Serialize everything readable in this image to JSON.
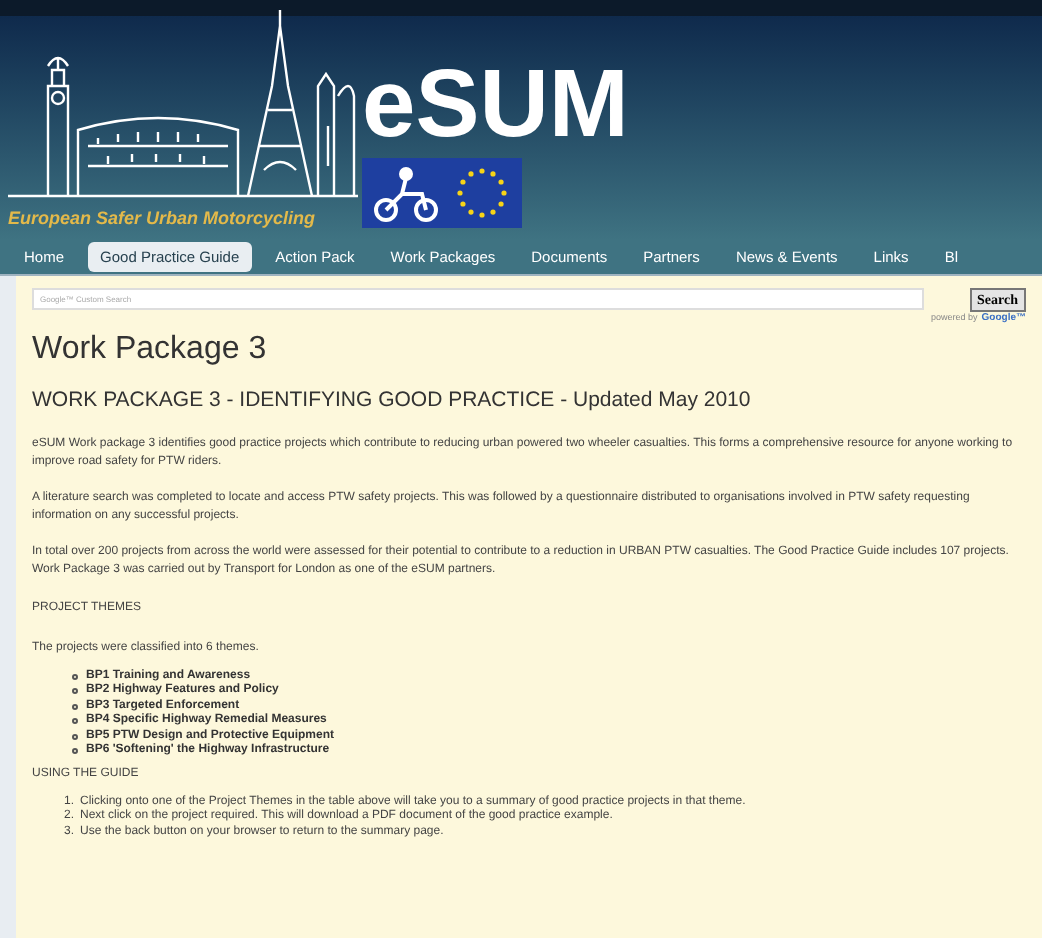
{
  "header": {
    "logo_text": "eSUM",
    "tagline": "European Safer Urban Motorcycling"
  },
  "nav": [
    {
      "label": "Home",
      "selected": false
    },
    {
      "label": "Good Practice Guide",
      "selected": true
    },
    {
      "label": "Action Pack",
      "selected": false
    },
    {
      "label": "Work Packages",
      "selected": false
    },
    {
      "label": "Documents",
      "selected": false
    },
    {
      "label": "Partners",
      "selected": false
    },
    {
      "label": "News & Events",
      "selected": false
    },
    {
      "label": "Links",
      "selected": false
    },
    {
      "label": "Bl",
      "selected": false
    }
  ],
  "search": {
    "placeholder": "Google™ Custom Search",
    "button": "Search",
    "powered_by": "powered by",
    "brand": "Google™"
  },
  "page_title": "Work Package 3",
  "heading": "WORK PACKAGE 3 - IDENTIFYING GOOD PRACTICE - Updated May 2010",
  "paragraphs": [
    "eSUM Work package 3 identifies good practice projects which contribute to reducing urban powered two wheeler casualties. This forms a comprehensive resource for anyone working to improve road safety for PTW riders.",
    "A literature search was completed to locate and access PTW safety projects. This was followed by a questionnaire distributed to organisations involved in PTW safety requesting information on any successful projects.",
    "In total over 200 projects from across the world were assessed for their potential to contribute to a reduction in URBAN PTW casualties. The Good Practice Guide includes 107 projects. Work Package 3 was carried out by Transport for London as one of the eSUM partners."
  ],
  "themes_heading": "PROJECT THEMES",
  "themes_intro": "The projects were classified into 6 themes.",
  "themes": [
    "BP1 Training and Awareness",
    "BP2 Highway Features and Policy",
    "BP3 Targeted Enforcement",
    "BP4 Specific Highway Remedial Measures",
    "BP5 PTW Design and Protective Equipment",
    "BP6 'Softening' the Highway Infrastructure"
  ],
  "guide_heading": "USING THE GUIDE",
  "steps": [
    {
      "number": "1.",
      "text": "Clicking onto one of the Project Themes in the table above will take you to a summary of good practice projects in that theme."
    },
    {
      "number": "2.",
      "text": "Next click on the project required. This will download a PDF document of the good practice example."
    },
    {
      "number": "3.",
      "text": "Use the back button on your browser to return to the summary page."
    }
  ]
}
